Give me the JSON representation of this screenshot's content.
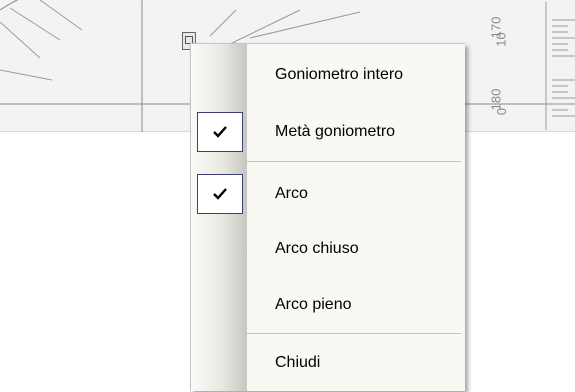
{
  "protractor": {
    "ticks": [
      "170",
      "10",
      "180",
      "0"
    ]
  },
  "menu": {
    "items": [
      {
        "label": "Goniometro intero",
        "checked": false
      },
      {
        "label": "Metà goniometro",
        "checked": true
      },
      {
        "label": "Arco",
        "checked": true
      },
      {
        "label": "Arco chiuso",
        "checked": false
      },
      {
        "label": "Arco pieno",
        "checked": false
      },
      {
        "label": "Chiudi",
        "checked": false
      }
    ]
  },
  "icons": {
    "checkmark": "check-icon",
    "handle": "protractor-handle-icon"
  },
  "colors": {
    "check_border": "#3b3f76",
    "menu_background": "#f9f8f3"
  }
}
